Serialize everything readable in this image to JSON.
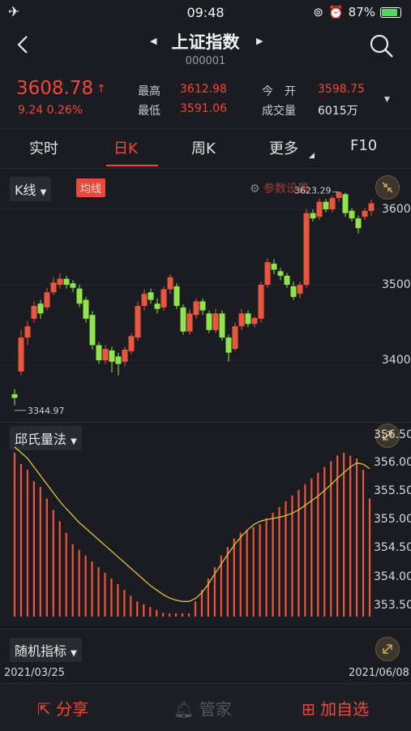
{
  "status": {
    "time": "09:48",
    "battery": "87%"
  },
  "header": {
    "title": "上证指数",
    "code": "000001"
  },
  "quote": {
    "price": "3608.78",
    "change": "9.24  0.26%",
    "high_label": "最高",
    "high": "3612.98",
    "low_label": "最低",
    "low": "3591.06",
    "open_label": "今　开",
    "open": "3598.75",
    "volume_label": "成交量",
    "volume": "6015万"
  },
  "tabs": [
    {
      "label": "实时"
    },
    {
      "label": "日K"
    },
    {
      "label": "周K"
    },
    {
      "label": "更多"
    },
    {
      "label": "F10"
    }
  ],
  "kline": {
    "selector": "K线",
    "ma_button": "均线",
    "settings": "参数设置",
    "max_label": "3623.29",
    "min_label": "3344.97",
    "y_ticks": [
      "3600",
      "3500",
      "3400"
    ],
    "candles": [
      [
        3355,
        3350,
        3340,
        3362
      ],
      [
        3385,
        3430,
        3380,
        3440
      ],
      [
        3430,
        3445,
        3420,
        3452
      ],
      [
        3455,
        3472,
        3450,
        3478
      ],
      [
        3475,
        3462,
        3455,
        3480
      ],
      [
        3470,
        3490,
        3466,
        3496
      ],
      [
        3490,
        3503,
        3486,
        3510
      ],
      [
        3500,
        3508,
        3495,
        3515
      ],
      [
        3508,
        3500,
        3495,
        3512
      ],
      [
        3502,
        3496,
        3490,
        3506
      ],
      [
        3495,
        3475,
        3470,
        3500
      ],
      [
        3480,
        3455,
        3450,
        3484
      ],
      [
        3460,
        3420,
        3414,
        3465
      ],
      [
        3420,
        3400,
        3395,
        3424
      ],
      [
        3400,
        3415,
        3395,
        3420
      ],
      [
        3413,
        3398,
        3384,
        3418
      ],
      [
        3405,
        3395,
        3380,
        3410
      ],
      [
        3398,
        3414,
        3392,
        3418
      ],
      [
        3412,
        3432,
        3408,
        3436
      ],
      [
        3430,
        3472,
        3426,
        3478
      ],
      [
        3472,
        3488,
        3466,
        3494
      ],
      [
        3490,
        3480,
        3475,
        3495
      ],
      [
        3475,
        3468,
        3462,
        3482
      ],
      [
        3470,
        3494,
        3466,
        3498
      ],
      [
        3494,
        3510,
        3488,
        3514
      ],
      [
        3498,
        3472,
        3468,
        3502
      ],
      [
        3470,
        3438,
        3434,
        3474
      ],
      [
        3438,
        3462,
        3434,
        3468
      ],
      [
        3460,
        3478,
        3455,
        3482
      ],
      [
        3478,
        3466,
        3460,
        3482
      ],
      [
        3462,
        3440,
        3436,
        3466
      ],
      [
        3440,
        3462,
        3436,
        3468
      ],
      [
        3462,
        3430,
        3426,
        3466
      ],
      [
        3430,
        3410,
        3398,
        3434
      ],
      [
        3415,
        3445,
        3412,
        3450
      ],
      [
        3445,
        3462,
        3440,
        3468
      ],
      [
        3462,
        3448,
        3444,
        3466
      ],
      [
        3448,
        3456,
        3444,
        3458
      ],
      [
        3455,
        3500,
        3450,
        3504
      ],
      [
        3500,
        3530,
        3496,
        3535
      ],
      [
        3528,
        3520,
        3514,
        3534
      ],
      [
        3518,
        3512,
        3506,
        3522
      ],
      [
        3512,
        3500,
        3496,
        3516
      ],
      [
        3498,
        3484,
        3480,
        3504
      ],
      [
        3488,
        3500,
        3482,
        3504
      ],
      [
        3500,
        3595,
        3496,
        3600
      ],
      [
        3595,
        3588,
        3584,
        3600
      ],
      [
        3590,
        3610,
        3586,
        3614
      ],
      [
        3610,
        3600,
        3596,
        3614
      ],
      [
        3600,
        3615,
        3596,
        3618
      ],
      [
        3615,
        3623,
        3610,
        3623
      ],
      [
        3620,
        3595,
        3590,
        3622
      ],
      [
        3598,
        3588,
        3584,
        3602
      ],
      [
        3588,
        3575,
        3568,
        3592
      ],
      [
        3590,
        3598,
        3586,
        3602
      ],
      [
        3598,
        3608,
        3591,
        3613
      ]
    ]
  },
  "qiu": {
    "selector": "邱氏量法",
    "y_ticks": [
      "356.50",
      "356.00",
      "355.50",
      "355.00",
      "354.50",
      "354.00",
      "353.50"
    ],
    "bars": [
      356.1,
      355.9,
      355.8,
      355.6,
      355.5,
      355.3,
      355.1,
      354.9,
      354.7,
      354.5,
      354.4,
      354.3,
      354.2,
      354.1,
      354.0,
      353.9,
      353.8,
      353.7,
      353.6,
      353.5,
      353.45,
      353.4,
      353.35,
      353.3,
      353.25,
      353.2,
      353.15,
      353.1,
      353.5,
      353.7,
      353.9,
      354.1,
      354.3,
      354.45,
      354.6,
      354.7,
      354.75,
      354.8,
      354.85,
      354.95,
      355.05,
      355.15,
      355.25,
      355.35,
      355.45,
      355.55,
      355.65,
      355.75,
      355.85,
      355.95,
      356.05,
      356.1,
      356.05,
      356.0,
      355.8,
      355.3
    ],
    "line": [
      356.2,
      356.1,
      356.0,
      355.85,
      355.7,
      355.55,
      355.4,
      355.25,
      355.12,
      355.0,
      354.88,
      354.78,
      354.68,
      354.58,
      354.48,
      354.38,
      354.28,
      354.18,
      354.08,
      353.98,
      353.88,
      353.78,
      353.7,
      353.62,
      353.56,
      353.52,
      353.5,
      353.5,
      353.55,
      353.65,
      353.8,
      353.98,
      354.15,
      354.32,
      354.48,
      354.62,
      354.74,
      354.84,
      354.9,
      354.93,
      354.95,
      354.97,
      355.0,
      355.04,
      355.1,
      355.18,
      355.26,
      355.34,
      355.44,
      355.54,
      355.65,
      355.75,
      355.85,
      355.92,
      355.9,
      355.82
    ]
  },
  "random": {
    "selector": "随机指标"
  },
  "dates": {
    "start": "2021/03/25",
    "end": "2021/06/08"
  },
  "bottom": {
    "share": "分享",
    "manager": "管家",
    "add": "加自选"
  }
}
